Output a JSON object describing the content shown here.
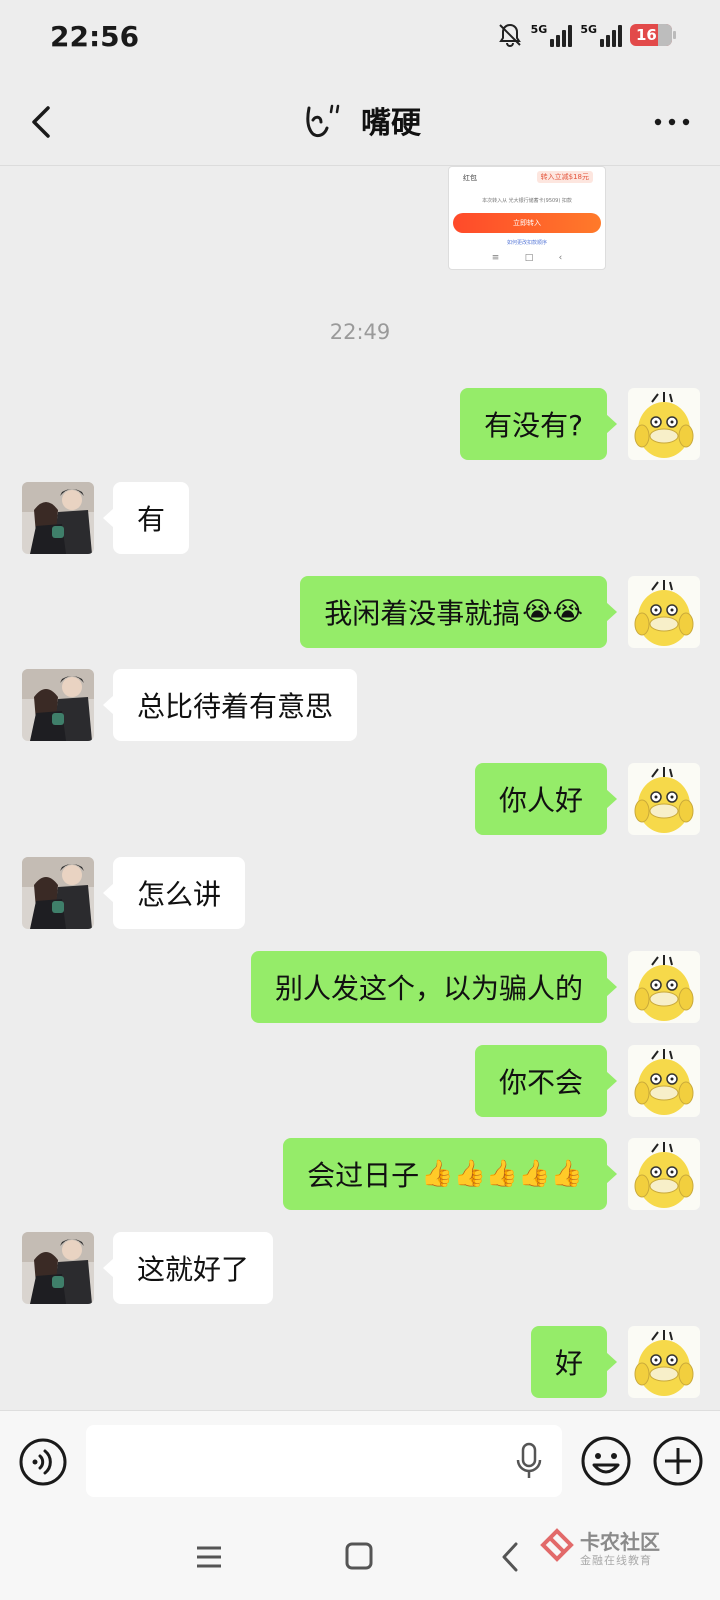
{
  "status_bar": {
    "time": "22:56",
    "network1": "5G",
    "network2": "5G",
    "battery": "16"
  },
  "header": {
    "title": "嘴硬"
  },
  "image_card": {
    "label_left": "红包",
    "label_tag": "转入立减$18元",
    "line": "本次转入从 光大银行储蓄卡(9509) 扣款",
    "button": "立即转入",
    "link": "如何更改扣款顺序"
  },
  "timestamp": "22:49",
  "messages": [
    {
      "from": "me",
      "text": "有没有?"
    },
    {
      "from": "other",
      "text": "有"
    },
    {
      "from": "me",
      "text": "我闲着没事就搞",
      "emoji": "😭😭"
    },
    {
      "from": "other",
      "text": "总比待着有意思"
    },
    {
      "from": "me",
      "text": "你人好"
    },
    {
      "from": "other",
      "text": "怎么讲"
    },
    {
      "from": "me",
      "text": "别人发这个，以为骗人的"
    },
    {
      "from": "me",
      "text": "你不会"
    },
    {
      "from": "me",
      "text": "会过日子",
      "emoji": "👍👍👍👍👍"
    },
    {
      "from": "other",
      "text": "这就好了"
    },
    {
      "from": "me",
      "text": "好"
    }
  ],
  "input": {
    "value": "",
    "placeholder": ""
  },
  "watermark": {
    "title": "卡农社区",
    "subtitle": "金融在线教育"
  },
  "colors": {
    "background": "#ededed",
    "my_bubble": "#95ec69",
    "other_bubble": "#ffffff",
    "battery_low": "#e24a4a"
  }
}
